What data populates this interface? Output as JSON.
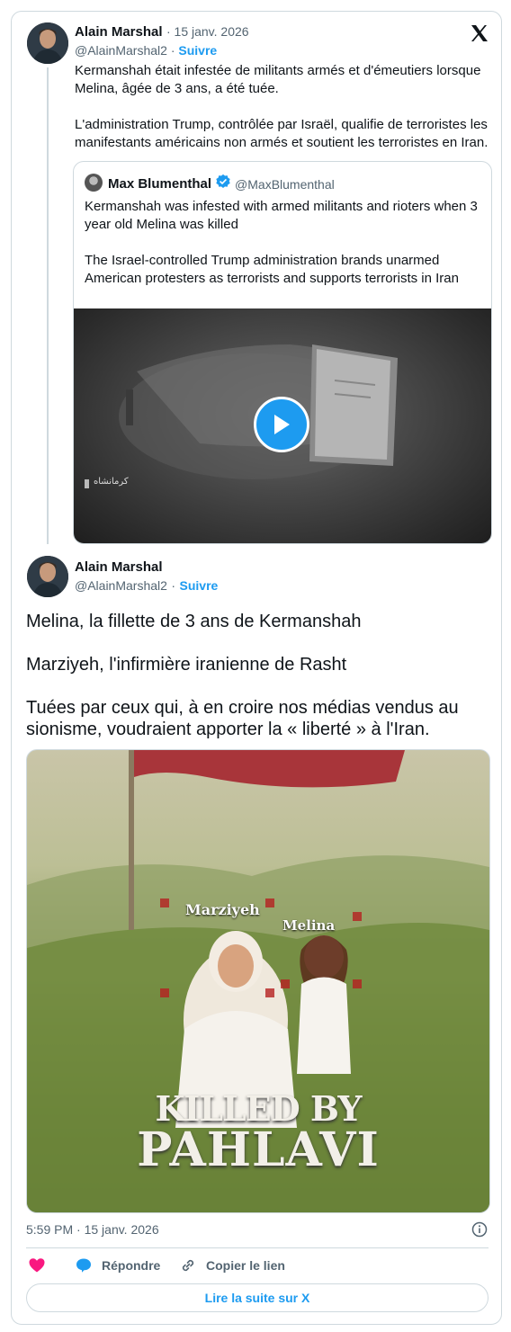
{
  "tweet1": {
    "author_name": "Alain Marshal",
    "date": "· 15 janv. 2026",
    "handle": "@AlainMarshal2",
    "dot": "·",
    "follow": "Suivre",
    "text": "Kermanshah était infestée de militants armés et d'émeutiers lorsque Melina, âgée de 3 ans, a été tuée.\n\nL'administration Trump, contrôlée par Israël, qualifie de terroristes les manifestants américains non armés et soutient les terroristes en Iran."
  },
  "quote": {
    "author_name": "Max Blumenthal",
    "handle": "@MaxBlumenthal",
    "text": "Kermanshah was infested with armed militants and rioters when 3 year old Melina was killed\n\nThe Israel-controlled Trump administration brands unarmed American protesters as terrorists and supports terrorists in Iran",
    "video_watermark": "کرمانشاه"
  },
  "tweet2": {
    "author_name": "Alain Marshal",
    "handle": "@AlainMarshal2",
    "dot": "·",
    "follow": "Suivre",
    "text": "Melina, la fillette de 3 ans de Kermanshah\n\nMarziyeh, l'infirmière iranienne de Rasht\n\nTuées par ceux qui, à en croire nos médias vendus au sionisme, voudraient apporter la « liberté » à l'Iran.",
    "poster": {
      "label_left": "Marziyeh",
      "label_right": "Melina",
      "headline_1": "KILLED BY",
      "headline_2": "PAHLAVI"
    },
    "timestamp": "5:59 PM · 15 janv. 2026"
  },
  "actions": {
    "reply": "Répondre",
    "copy_link": "Copier le lien",
    "read_more": "Lire la suite sur X"
  },
  "colors": {
    "accent": "#1d9bf0",
    "like": "#f91880",
    "border": "#cfd9de",
    "muted": "#536471"
  }
}
